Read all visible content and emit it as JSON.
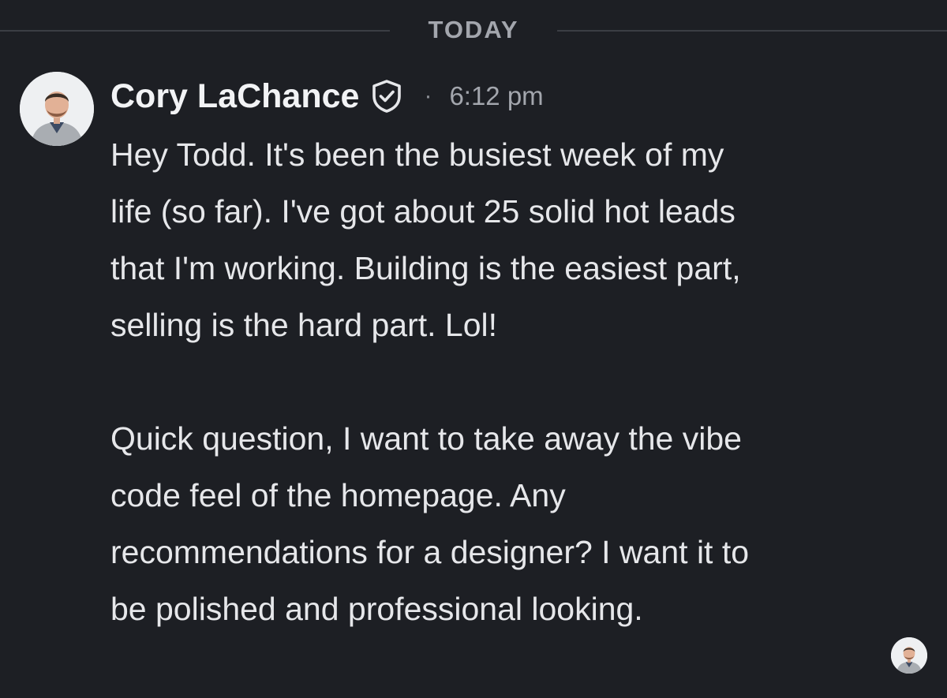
{
  "divider": {
    "label": "TODAY"
  },
  "message": {
    "author": "Cory LaChance",
    "separator": "·",
    "time": "6:12 pm",
    "avatar_icon": "user-avatar",
    "verified_icon": "shield-check-icon",
    "paragraphs": [
      [
        "Hey Todd. It's been the busiest week of my",
        "life (so far). I've got about 25 solid hot leads",
        "that I'm working. Building is the easiest part,",
        "selling is the hard part. Lol!"
      ],
      [
        "Quick question, I want to take away the vibe",
        "code feel of the homepage. Any",
        "recommendations for a designer? I want it to",
        "be polished and professional looking."
      ]
    ]
  },
  "read_receipt": {
    "icon": "user-avatar"
  },
  "colors": {
    "background": "#1d1f24",
    "text": "#e6e7ea",
    "muted": "#a3a6ad",
    "divider_line": "#3b3e44"
  }
}
